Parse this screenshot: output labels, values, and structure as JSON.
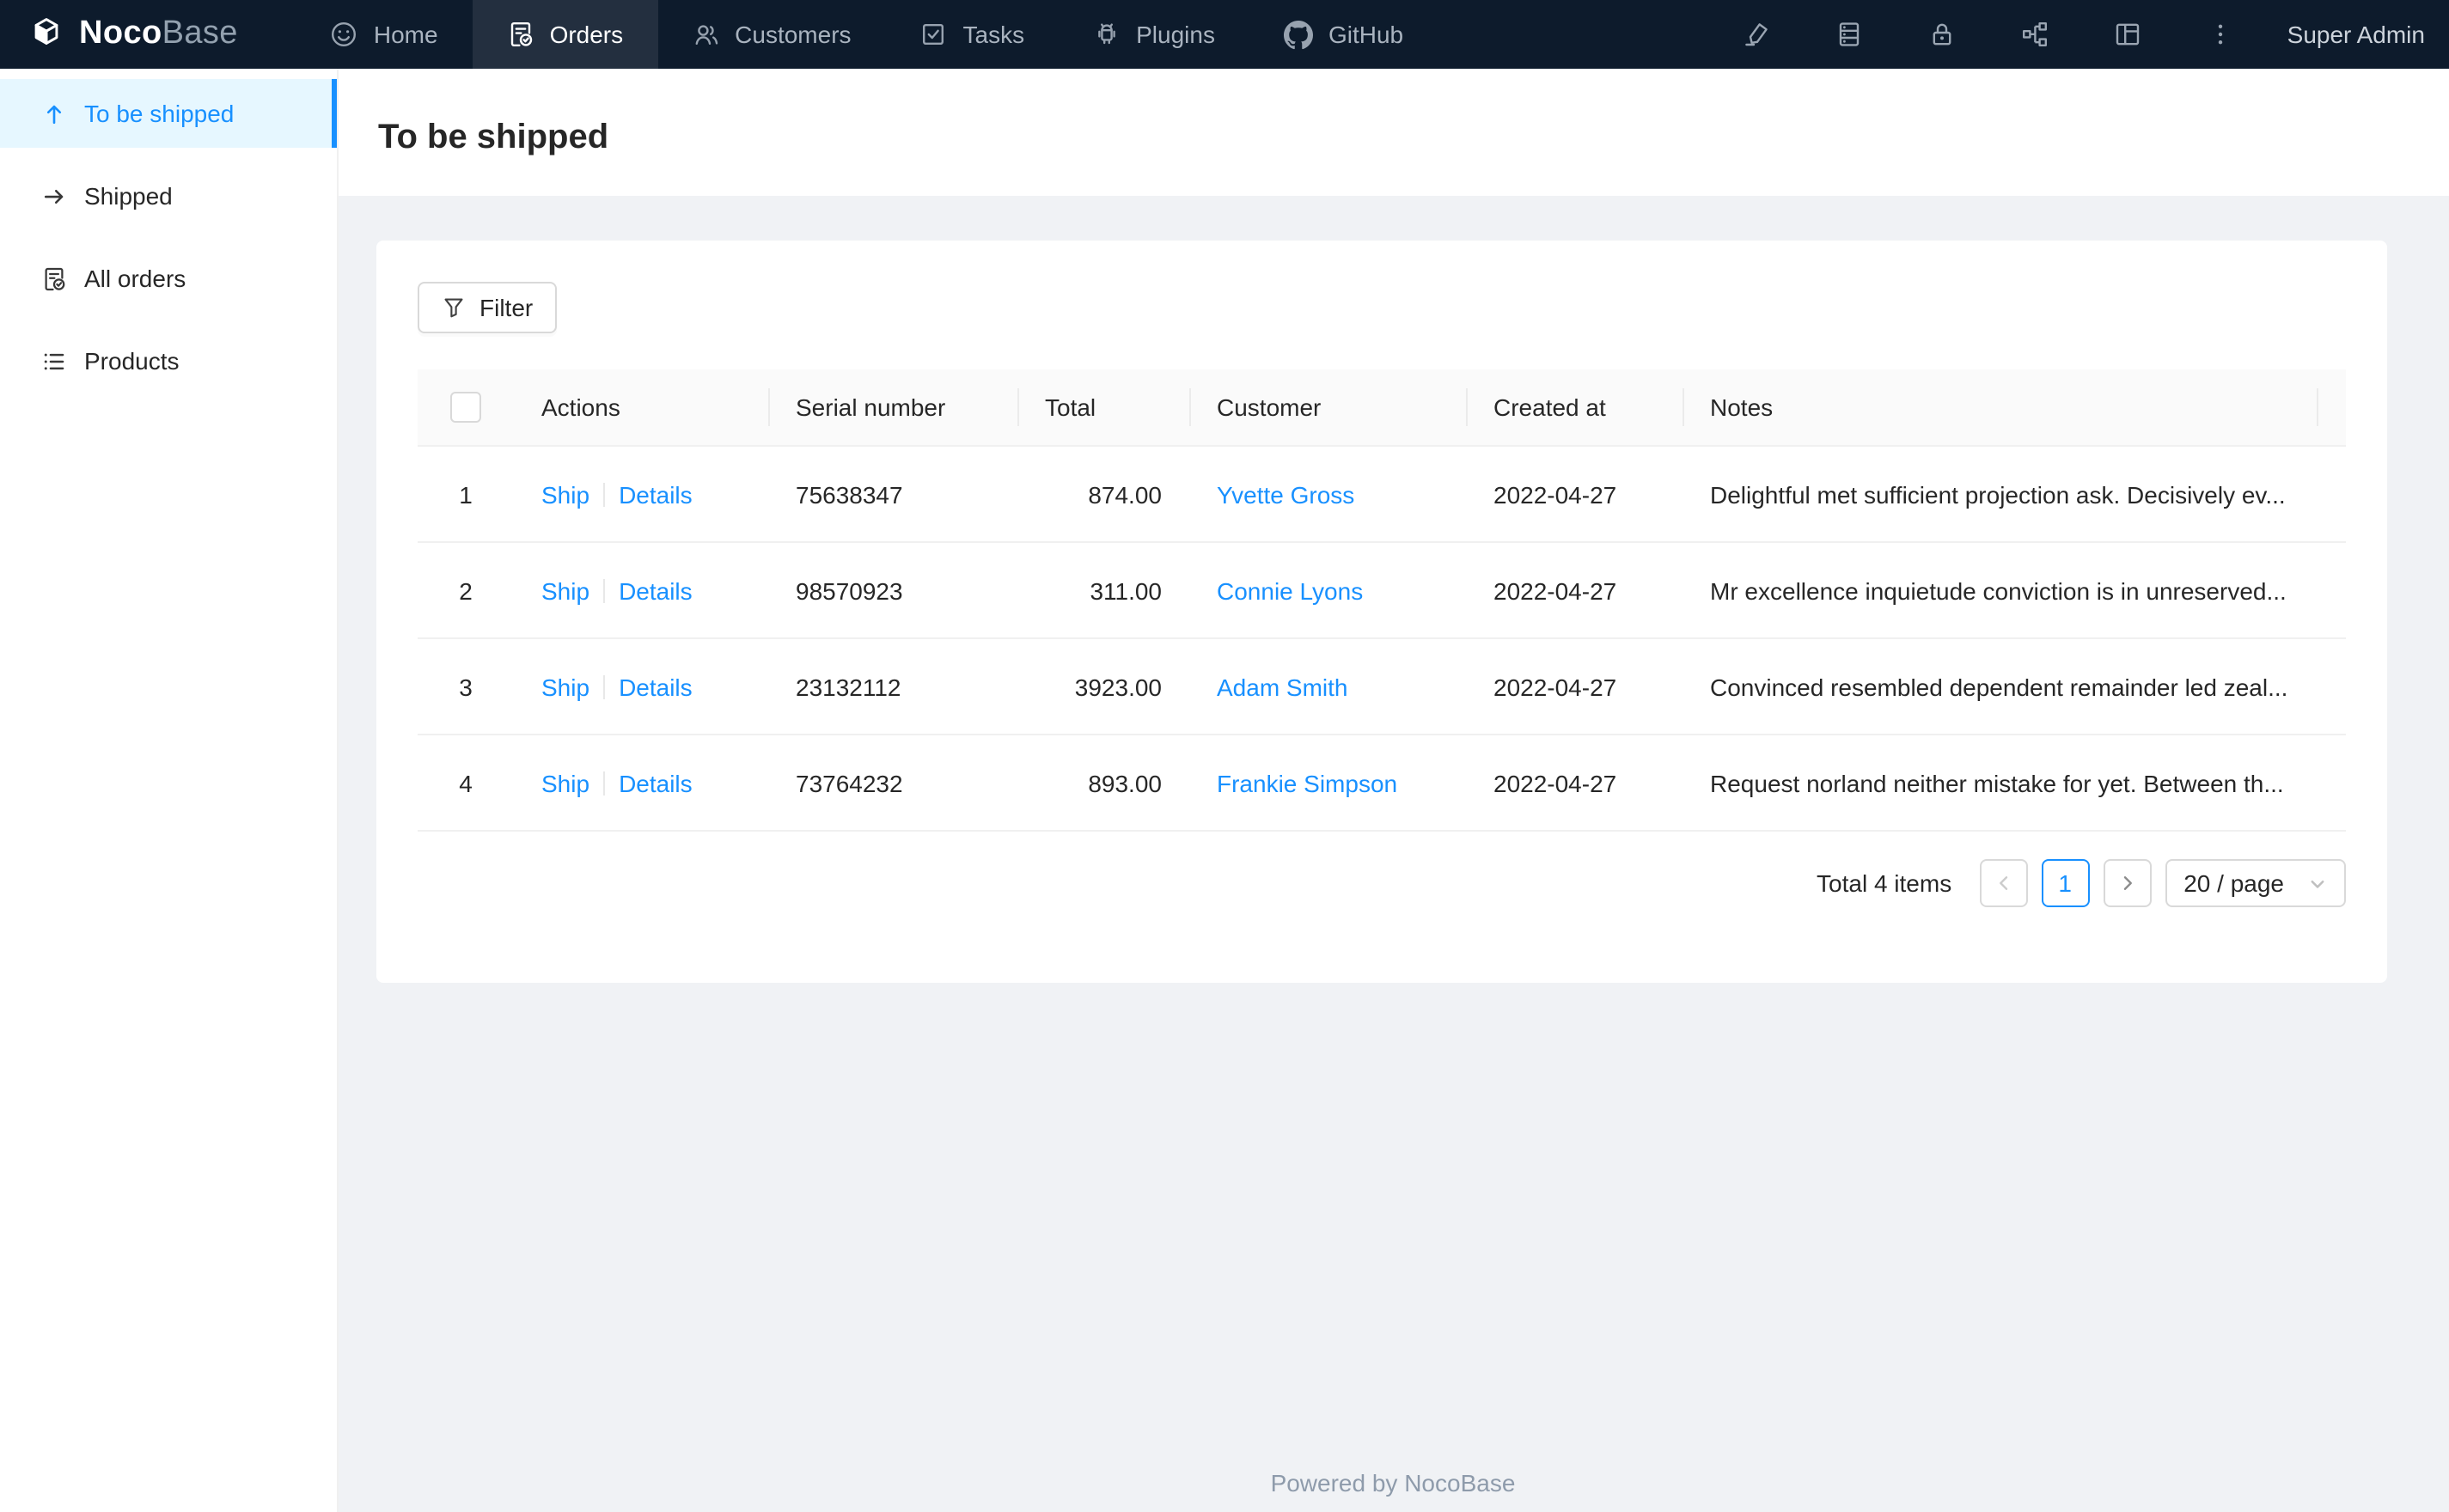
{
  "nav": {
    "logo": {
      "brand_bold": "Noco",
      "brand_light": "Base"
    },
    "items": [
      {
        "label": "Home",
        "icon": "smile-icon",
        "active": false
      },
      {
        "label": "Orders",
        "icon": "file-done-icon",
        "active": true
      },
      {
        "label": "Customers",
        "icon": "team-icon",
        "active": false
      },
      {
        "label": "Tasks",
        "icon": "check-square-icon",
        "active": false
      },
      {
        "label": "Plugins",
        "icon": "android-icon",
        "active": false
      },
      {
        "label": "GitHub",
        "icon": "github-icon",
        "active": false
      }
    ],
    "right_icons": [
      "highlighter-icon",
      "database-icon",
      "lock-icon",
      "org-chart-icon",
      "layout-icon",
      "more-icon"
    ],
    "user": "Super Admin"
  },
  "sidebar": {
    "items": [
      {
        "label": "To be shipped",
        "icon": "arrow-up-icon",
        "active": true
      },
      {
        "label": "Shipped",
        "icon": "arrow-right-icon",
        "active": false
      },
      {
        "label": "All orders",
        "icon": "file-done-icon",
        "active": false
      },
      {
        "label": "Products",
        "icon": "unordered-list-icon",
        "active": false
      }
    ]
  },
  "page": {
    "title": "To be shipped"
  },
  "toolbar": {
    "filter_label": "Filter"
  },
  "table": {
    "columns": [
      "Actions",
      "Serial number",
      "Total",
      "Customer",
      "Created at",
      "Notes"
    ],
    "action_labels": [
      "Ship",
      "Details"
    ],
    "rows": [
      {
        "index": "1",
        "serial": "75638347",
        "total": "874.00",
        "customer": "Yvette Gross",
        "created_at": "2022-04-27",
        "notes": "Delightful met sufficient projection ask. Decisively ev..."
      },
      {
        "index": "2",
        "serial": "98570923",
        "total": "311.00",
        "customer": "Connie Lyons",
        "created_at": "2022-04-27",
        "notes": "Mr excellence inquietude conviction is in unreserved..."
      },
      {
        "index": "3",
        "serial": "23132112",
        "total": "3923.00",
        "customer": "Adam Smith",
        "created_at": "2022-04-27",
        "notes": "Convinced resembled dependent remainder led zeal..."
      },
      {
        "index": "4",
        "serial": "73764232",
        "total": "893.00",
        "customer": "Frankie Simpson",
        "created_at": "2022-04-27",
        "notes": "Request norland neither mistake for yet. Between th..."
      }
    ]
  },
  "pagination": {
    "total_text": "Total 4 items",
    "current_page": "1",
    "page_size": "20 / page"
  },
  "footer": {
    "text": "Powered by NocoBase"
  },
  "colors": {
    "accent": "#1890ff",
    "navbar_bg": "#0d1b2c",
    "navbar_active_bg": "#232f3f",
    "sidebar_active_bg": "#e6f7ff",
    "content_bg": "#f0f2f5",
    "table_header_bg": "#fafafa",
    "row_border": "#f0f0f0",
    "footer_text": "#8e9bab"
  }
}
